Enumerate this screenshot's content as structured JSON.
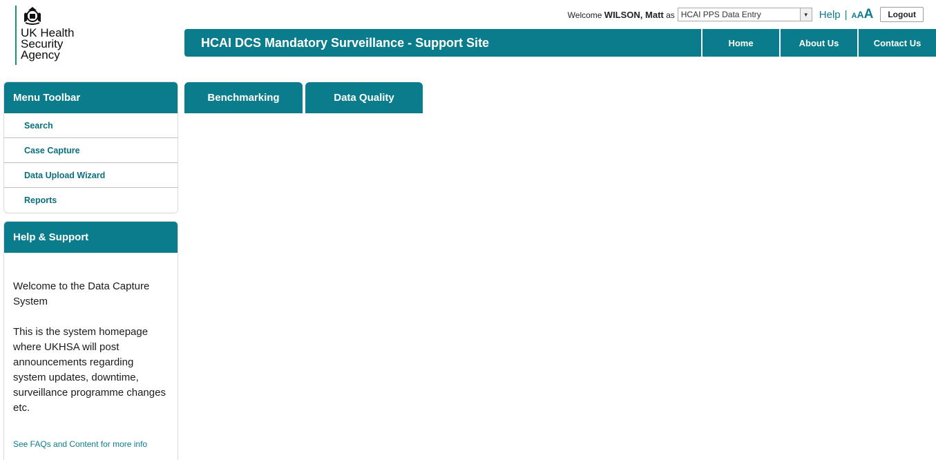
{
  "logo": {
    "line1": "UK Health",
    "line2": "Security",
    "line3": "Agency",
    "icon": "royal-crest-icon"
  },
  "user_bar": {
    "welcome_prefix": "Welcome",
    "user_name": "WILSON, Matt",
    "as_text": "as",
    "role_value": "HCAI PPS Data Entry",
    "help_label": "Help",
    "separator": "|",
    "text_size": {
      "small": "A",
      "medium": "A",
      "large": "A"
    },
    "logout_label": "Logout"
  },
  "header": {
    "title": "HCAI DCS Mandatory Surveillance - Support Site",
    "nav": [
      {
        "label": "Home"
      },
      {
        "label": "About Us"
      },
      {
        "label": "Contact Us"
      }
    ]
  },
  "menu_toolbar": {
    "title": "Menu Toolbar",
    "items": [
      {
        "label": "Search"
      },
      {
        "label": "Case Capture"
      },
      {
        "label": "Data Upload Wizard"
      },
      {
        "label": "Reports"
      }
    ]
  },
  "help_support": {
    "title": "Help & Support",
    "paragraph1": "Welcome to the Data Capture System",
    "paragraph2": "This is the system homepage where UKHSA will post announcements regarding system updates, downtime, surveillance programme changes etc.",
    "more_link": "See FAQs and Content for more info"
  },
  "tabs": [
    {
      "label": "Benchmarking"
    },
    {
      "label": "Data Quality"
    }
  ],
  "colors": {
    "brand": "#0b7c8c",
    "logo_rule": "#1f8a80"
  }
}
